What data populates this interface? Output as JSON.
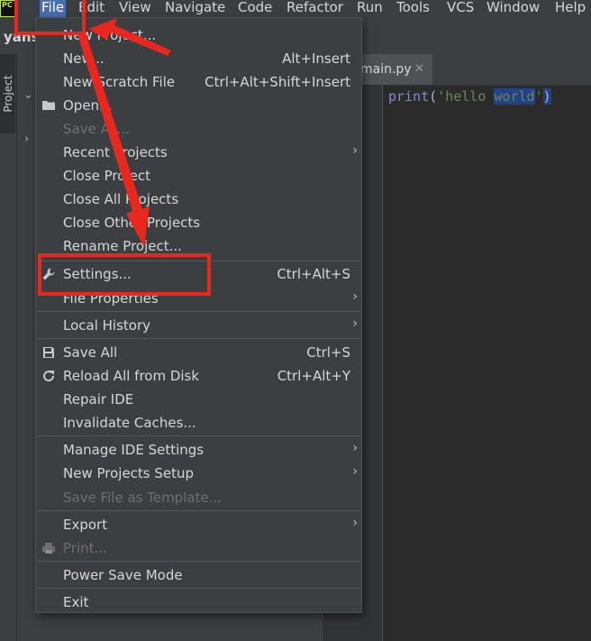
{
  "menubar": {
    "app_icon_text": "PC",
    "items": [
      "File",
      "Edit",
      "View",
      "Navigate",
      "Code",
      "Refactor",
      "Run",
      "Tools",
      "VCS",
      "Window",
      "Help"
    ]
  },
  "project": {
    "name": "yans",
    "panel_tab": "Project"
  },
  "editor": {
    "tab_label": "main.py",
    "code_fn": "print",
    "code_open": "(",
    "code_str_a": "'hello ",
    "code_str_b": "world",
    "code_str_c": "'",
    "code_close": ")"
  },
  "file_menu": {
    "items": [
      {
        "label": "New Project...",
        "shortcut": "",
        "icon": "",
        "submenu": false,
        "disabled": false
      },
      {
        "label": "New...",
        "shortcut": "Alt+Insert",
        "icon": "",
        "submenu": false,
        "disabled": false
      },
      {
        "label": "New Scratch File",
        "shortcut": "Ctrl+Alt+Shift+Insert",
        "icon": "",
        "submenu": false,
        "disabled": false
      },
      {
        "label": "Open...",
        "shortcut": "",
        "icon": "folder-icon",
        "submenu": false,
        "disabled": false
      },
      {
        "label": "Save As...",
        "shortcut": "",
        "icon": "",
        "submenu": false,
        "disabled": true
      },
      {
        "label": "Recent Projects",
        "shortcut": "",
        "icon": "",
        "submenu": true,
        "disabled": false
      },
      {
        "label": "Close Project",
        "shortcut": "",
        "icon": "",
        "submenu": false,
        "disabled": false
      },
      {
        "label": "Close All Projects",
        "shortcut": "",
        "icon": "",
        "submenu": false,
        "disabled": false
      },
      {
        "label": "Close Other Projects",
        "shortcut": "",
        "icon": "",
        "submenu": false,
        "disabled": false
      },
      {
        "label": "Rename Project...",
        "shortcut": "",
        "icon": "",
        "submenu": false,
        "disabled": false
      },
      {
        "label": "Settings...",
        "shortcut": "Ctrl+Alt+S",
        "icon": "wrench-icon",
        "submenu": false,
        "disabled": false
      },
      {
        "label": "File Properties",
        "shortcut": "",
        "icon": "",
        "submenu": true,
        "disabled": false
      },
      {
        "label": "Local History",
        "shortcut": "",
        "icon": "",
        "submenu": true,
        "disabled": false
      },
      {
        "label": "Save All",
        "shortcut": "Ctrl+S",
        "icon": "save-icon",
        "submenu": false,
        "disabled": false
      },
      {
        "label": "Reload All from Disk",
        "shortcut": "Ctrl+Alt+Y",
        "icon": "reload-icon",
        "submenu": false,
        "disabled": false
      },
      {
        "label": "Repair IDE",
        "shortcut": "",
        "icon": "",
        "submenu": false,
        "disabled": false
      },
      {
        "label": "Invalidate Caches...",
        "shortcut": "",
        "icon": "",
        "submenu": false,
        "disabled": false
      },
      {
        "label": "Manage IDE Settings",
        "shortcut": "",
        "icon": "",
        "submenu": true,
        "disabled": false
      },
      {
        "label": "New Projects Setup",
        "shortcut": "",
        "icon": "",
        "submenu": true,
        "disabled": false
      },
      {
        "label": "Save File as Template...",
        "shortcut": "",
        "icon": "",
        "submenu": false,
        "disabled": true
      },
      {
        "label": "Export",
        "shortcut": "",
        "icon": "",
        "submenu": true,
        "disabled": false
      },
      {
        "label": "Print...",
        "shortcut": "",
        "icon": "printer-icon",
        "submenu": false,
        "disabled": true
      },
      {
        "label": "Power Save Mode",
        "shortcut": "",
        "icon": "",
        "submenu": false,
        "disabled": false
      },
      {
        "label": "Exit",
        "shortcut": "",
        "icon": "",
        "submenu": false,
        "disabled": false
      }
    ]
  },
  "annotation_color": "#e8271e"
}
